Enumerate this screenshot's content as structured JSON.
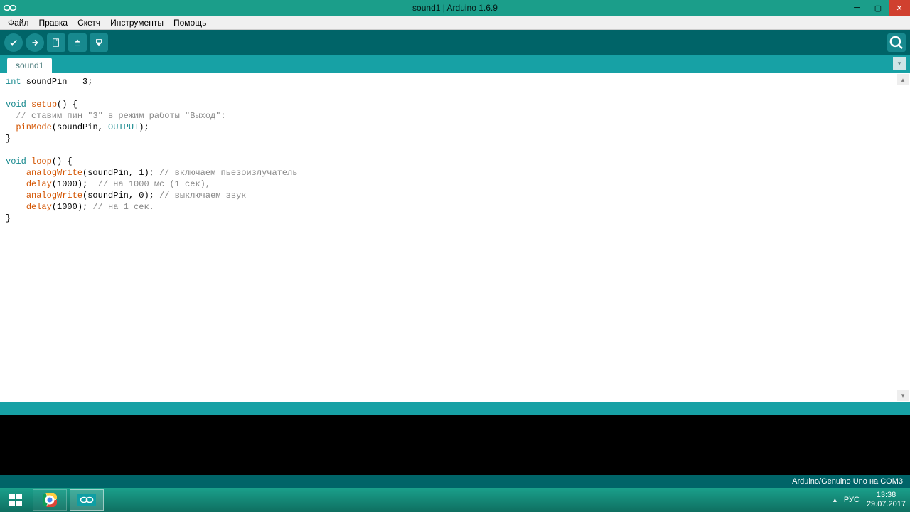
{
  "window": {
    "title": "sound1 | Arduino 1.6.9"
  },
  "menu": {
    "items": [
      "Файл",
      "Правка",
      "Скетч",
      "Инструменты",
      "Помощь"
    ]
  },
  "tabs": {
    "active": "sound1"
  },
  "footer": {
    "board": "Arduino/Genuino Uno на COM3"
  },
  "code": {
    "l1_kw": "int",
    "l1_rest": " soundPin = 3;",
    "l3_kw": "void",
    "l3_fn": " setup",
    "l3_rest": "() {",
    "l4_comment": "  // ставим пин \"3\" в режим работы \"Выход\":",
    "l5_indent": "  ",
    "l5_fn": "pinMode",
    "l5_open": "(soundPin, ",
    "l5_const": "OUTPUT",
    "l5_close": ");",
    "l6": "}",
    "l8_kw": "void",
    "l8_fn": " loop",
    "l8_rest": "() {",
    "l9_indent": "    ",
    "l9_fn": "analogWrite",
    "l9_args": "(soundPin, 1); ",
    "l9_comment": "// включаем пьезоизлучатель",
    "l10_indent": "    ",
    "l10_fn": "delay",
    "l10_args": "(1000);  ",
    "l10_comment": "// на 1000 мс (1 сек),",
    "l11_indent": "    ",
    "l11_fn": "analogWrite",
    "l11_args": "(soundPin, 0); ",
    "l11_comment": "// выключаем звук",
    "l12_indent": "    ",
    "l12_fn": "delay",
    "l12_args": "(1000); ",
    "l12_comment": "// на 1 сек.",
    "l13": "}"
  },
  "tray": {
    "lang": "РУС",
    "time": "13:38",
    "date": "29.07.2017"
  }
}
